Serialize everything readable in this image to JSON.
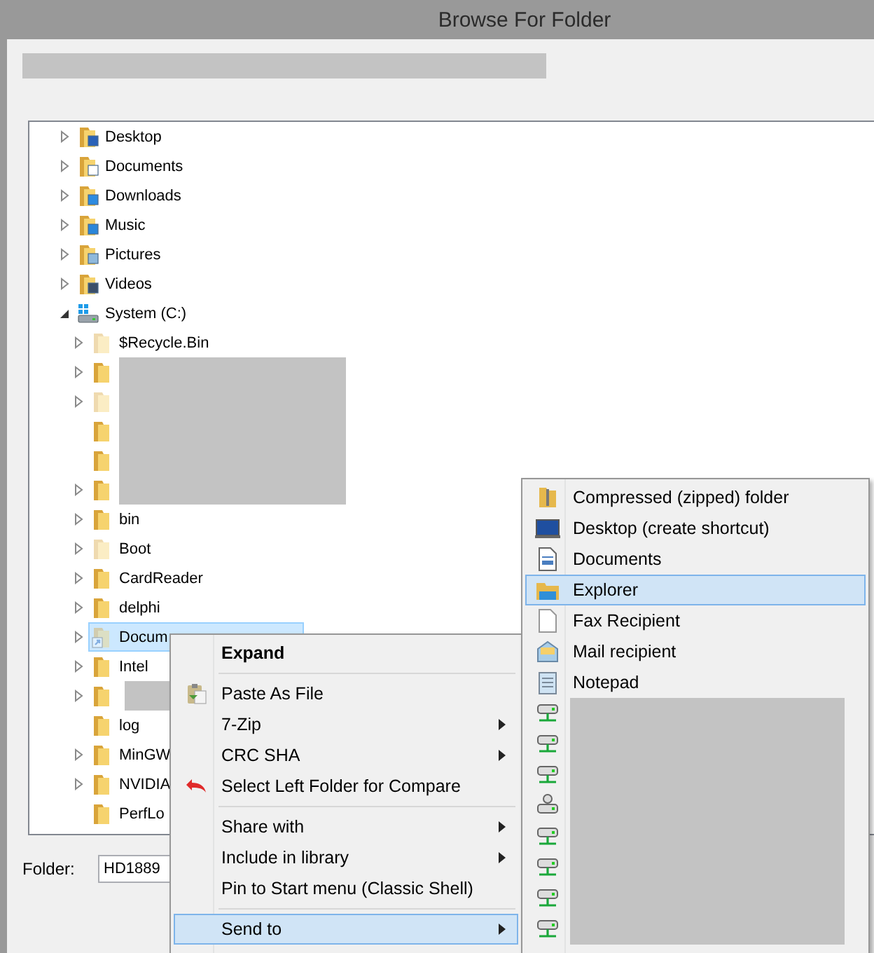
{
  "window": {
    "title": "Browse For Folder"
  },
  "tree": [
    {
      "label": "Desktop",
      "kind": "desktop",
      "expanded": false,
      "selected": false
    },
    {
      "label": "Documents",
      "kind": "documents",
      "expanded": false,
      "selected": false
    },
    {
      "label": "Downloads",
      "kind": "downloads",
      "expanded": false,
      "selected": false
    },
    {
      "label": "Music",
      "kind": "music",
      "expanded": false,
      "selected": false
    },
    {
      "label": "Pictures",
      "kind": "pictures",
      "expanded": false,
      "selected": false
    },
    {
      "label": "Videos",
      "kind": "videos",
      "expanded": false,
      "selected": false
    },
    {
      "label": "System (C:)",
      "kind": "drive",
      "expanded": true,
      "selected": false,
      "children": [
        {
          "label": "$Recycle.Bin",
          "kind": "folder",
          "expanded": false,
          "hidden": true,
          "selected": false
        },
        {
          "kind": "redacted",
          "expanded": false,
          "hidden": false,
          "selected": false
        },
        {
          "kind": "redacted",
          "expanded": false,
          "hidden": true,
          "selected": false
        },
        {
          "kind": "redacted",
          "hidden": false,
          "selected": false
        },
        {
          "kind": "redacted",
          "hidden": false,
          "selected": false
        },
        {
          "kind": "redacted",
          "expanded": false,
          "hidden": false,
          "selected": false
        },
        {
          "label": "bin",
          "kind": "folder",
          "expanded": false,
          "hidden": false,
          "selected": false
        },
        {
          "label": "Boot",
          "kind": "folder",
          "expanded": false,
          "hidden": true,
          "selected": false
        },
        {
          "label": "CardReader",
          "kind": "folder",
          "expanded": false,
          "hidden": false,
          "selected": false
        },
        {
          "label": "delphi",
          "kind": "folder",
          "expanded": false,
          "hidden": false,
          "selected": false
        },
        {
          "label": "Docum",
          "kind": "folder",
          "expanded": false,
          "hidden": true,
          "shortcut": true,
          "selected": true
        },
        {
          "label": "Intel",
          "kind": "folder",
          "expanded": false,
          "hidden": false,
          "selected": false
        },
        {
          "kind": "redacted-short",
          "expanded": false,
          "hidden": false,
          "selected": false
        },
        {
          "label": "log",
          "kind": "folder",
          "hidden": false,
          "selected": false
        },
        {
          "label": "MinGW",
          "kind": "folder",
          "expanded": false,
          "hidden": false,
          "selected": false
        },
        {
          "label": "NVIDIA",
          "kind": "folder",
          "expanded": false,
          "hidden": false,
          "selected": false
        },
        {
          "label": "PerfLo",
          "kind": "folder",
          "hidden": false,
          "selected": false
        }
      ]
    }
  ],
  "folder_field": {
    "label": "Folder:",
    "value": "HD1889"
  },
  "context_menu": [
    {
      "kind": "item",
      "label": "Expand",
      "default": true,
      "submenu": false,
      "selected": false
    },
    {
      "kind": "separator"
    },
    {
      "kind": "paste-item",
      "label": "Paste As File",
      "submenu": false,
      "selected": false
    },
    {
      "kind": "item",
      "label": "7-Zip",
      "submenu": true,
      "selected": false
    },
    {
      "kind": "item",
      "label": "CRC SHA",
      "submenu": true,
      "selected": false
    },
    {
      "kind": "compare-item",
      "label": "Select Left Folder for Compare",
      "submenu": false,
      "selected": false
    },
    {
      "kind": "separator"
    },
    {
      "kind": "item",
      "label": "Share with",
      "submenu": true,
      "selected": false
    },
    {
      "kind": "item",
      "label": "Include in library",
      "submenu": true,
      "selected": false
    },
    {
      "kind": "item",
      "label": "Pin to Start menu (Classic Shell)",
      "submenu": false,
      "selected": false
    },
    {
      "kind": "separator"
    },
    {
      "kind": "item",
      "label": "Send to",
      "submenu": true,
      "selected": true
    }
  ],
  "send_to_menu": [
    {
      "kind": "zip",
      "label": "Compressed (zipped) folder",
      "selected": false
    },
    {
      "kind": "desktop",
      "label": "Desktop (create shortcut)",
      "selected": false
    },
    {
      "kind": "document",
      "label": "Documents",
      "selected": false
    },
    {
      "kind": "explorer",
      "label": "Explorer",
      "selected": true
    },
    {
      "kind": "page",
      "label": "Fax Recipient",
      "selected": false
    },
    {
      "kind": "mail",
      "label": "Mail recipient",
      "selected": false
    },
    {
      "kind": "notepad",
      "label": "Notepad",
      "selected": false
    },
    {
      "kind": "network",
      "selected": false
    },
    {
      "kind": "network",
      "selected": false
    },
    {
      "kind": "network",
      "selected": false
    },
    {
      "kind": "network-drive",
      "selected": false
    },
    {
      "kind": "network",
      "selected": false
    },
    {
      "kind": "network",
      "selected": false
    },
    {
      "kind": "network",
      "selected": false
    },
    {
      "kind": "network",
      "selected": false
    }
  ]
}
